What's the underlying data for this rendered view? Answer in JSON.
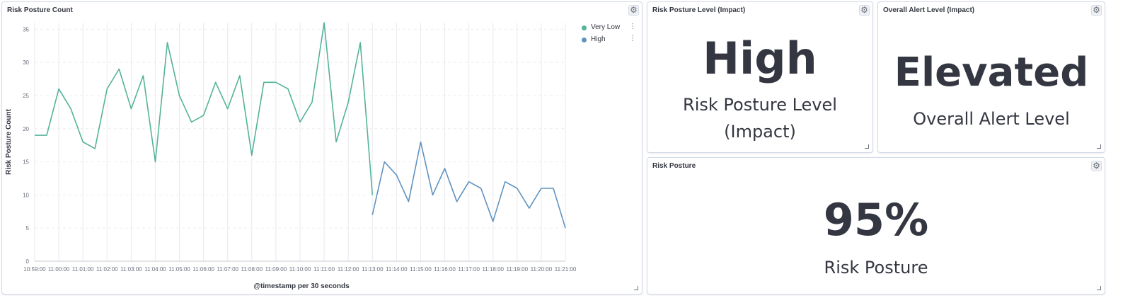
{
  "panels": {
    "risk_posture_count": {
      "title": "Risk Posture Count"
    },
    "risk_posture_level": {
      "title": "Risk Posture Level (Impact)",
      "value": "High",
      "label_line1": "Risk Posture Level",
      "label_line2": "(Impact)"
    },
    "overall_alert_level": {
      "title": "Overall Alert Level (Impact)",
      "value": "Elevated",
      "label": "Overall Alert Level"
    },
    "risk_posture": {
      "title": "Risk Posture",
      "value": "95%",
      "label": "Risk Posture"
    }
  },
  "icons": {
    "settings": "gear-icon",
    "resize": "resize-handle-icon",
    "legend_options": "more-options-icon"
  },
  "colors": {
    "very_low": "#54b399",
    "high": "#6092c0",
    "text": "#343741",
    "grid": "#eeeeee"
  },
  "chart_data": {
    "type": "line",
    "xlabel": "@timestamp per 30 seconds",
    "ylabel": "Risk Posture Count",
    "ylim": [
      0,
      36
    ],
    "yticks": [
      0,
      5,
      10,
      15,
      20,
      25,
      30,
      35
    ],
    "xticks": [
      "10:59:00",
      "11:00:00",
      "11:01:00",
      "11:02:00",
      "11:03:00",
      "11:04:00",
      "11:05:00",
      "11:06:00",
      "11:07:00",
      "11:08:00",
      "11:09:00",
      "11:10:00",
      "11:11:00",
      "11:12:00",
      "11:13:00",
      "11:14:00",
      "11:15:00",
      "11:16:00",
      "11:17:00",
      "11:18:00",
      "11:19:00",
      "11:20:00",
      "11:21:00"
    ],
    "legend": {
      "position": "top-right"
    },
    "series": [
      {
        "name": "Very Low",
        "color": "#54b399",
        "x": [
          "10:59:00",
          "10:59:30",
          "11:00:00",
          "11:00:30",
          "11:01:00",
          "11:01:30",
          "11:02:00",
          "11:02:30",
          "11:03:00",
          "11:03:30",
          "11:04:00",
          "11:04:30",
          "11:05:00",
          "11:05:30",
          "11:06:00",
          "11:06:30",
          "11:07:00",
          "11:07:30",
          "11:08:00",
          "11:08:30",
          "11:09:00",
          "11:09:30",
          "11:10:00",
          "11:10:30",
          "11:11:00",
          "11:11:30",
          "11:12:00",
          "11:12:30",
          "11:13:00"
        ],
        "values": [
          19,
          19,
          26,
          23,
          18,
          17,
          26,
          29,
          23,
          28,
          15,
          33,
          25,
          21,
          22,
          27,
          23,
          28,
          16,
          27,
          27,
          26,
          21,
          24,
          36,
          18,
          24,
          33,
          10
        ]
      },
      {
        "name": "High",
        "color": "#6092c0",
        "x": [
          "11:13:00",
          "11:13:30",
          "11:14:00",
          "11:14:30",
          "11:15:00",
          "11:15:30",
          "11:16:00",
          "11:16:30",
          "11:17:00",
          "11:17:30",
          "11:18:00",
          "11:18:30",
          "11:19:00",
          "11:19:30",
          "11:20:00",
          "11:20:30",
          "11:21:00"
        ],
        "values": [
          7,
          15,
          13,
          9,
          18,
          10,
          14,
          9,
          12,
          11,
          6,
          12,
          11,
          8,
          11,
          11,
          5
        ]
      }
    ]
  }
}
